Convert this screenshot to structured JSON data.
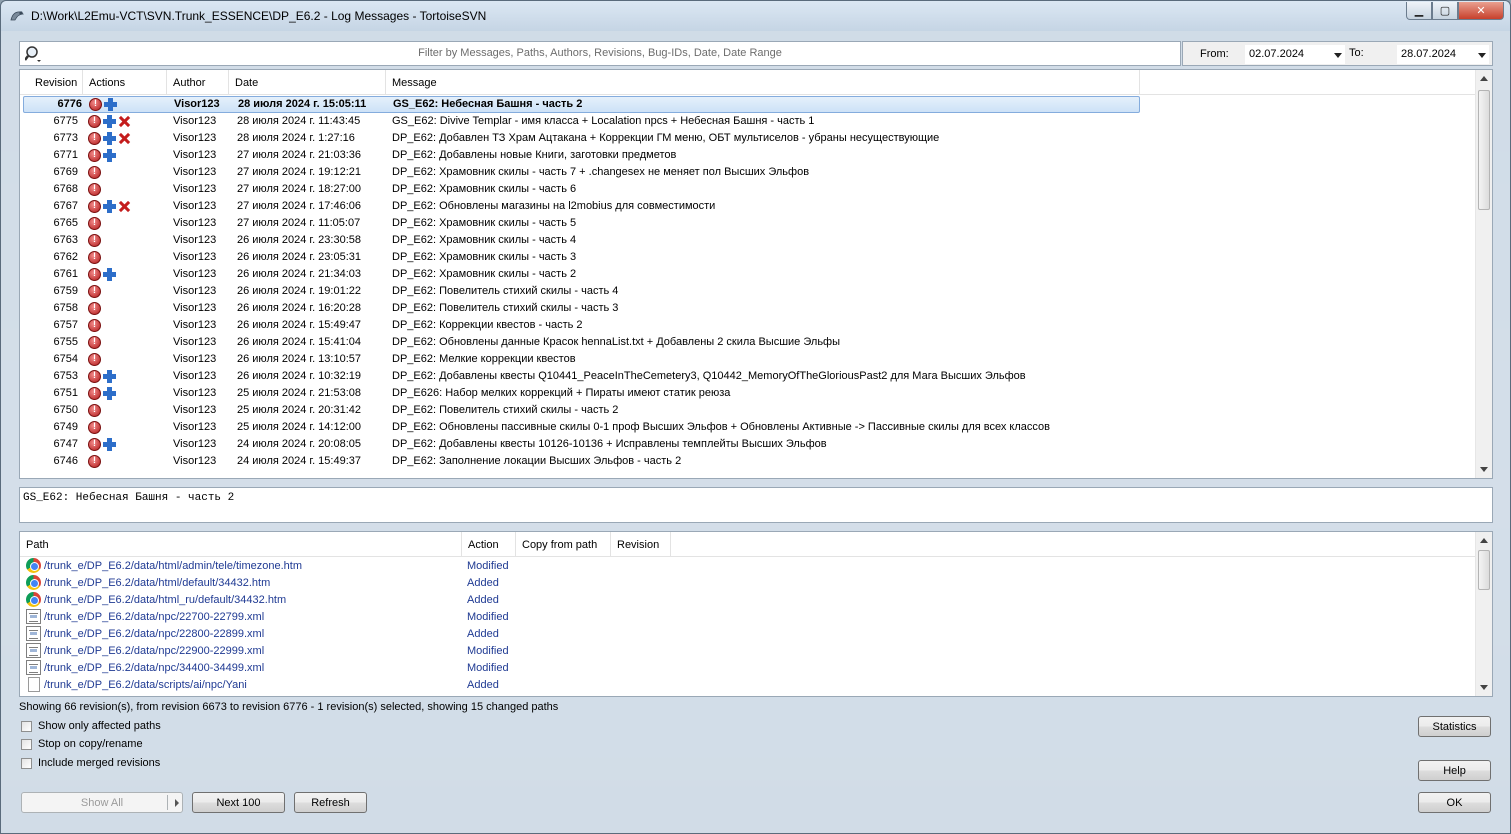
{
  "window": {
    "title": "D:\\Work\\L2Emu-VCT\\SVN.Trunk_ESSENCE\\DP_E6.2 - Log Messages - TortoiseSVN"
  },
  "filter": {
    "placeholder": "Filter by Messages, Paths, Authors, Revisions, Bug-IDs, Date, Date Range",
    "from_label": "From:",
    "from_value": "02.07.2024",
    "to_label": "To:",
    "to_value": "28.07.2024"
  },
  "log_columns": [
    "Revision",
    "Actions",
    "Author",
    "Date",
    "Message"
  ],
  "log_rows": [
    {
      "rev": "6776",
      "actions": [
        "mod",
        "add"
      ],
      "author": "Visor123",
      "date": "28 июля 2024 г. 15:05:11",
      "msg": "GS_E62: Небесная Башня - часть 2",
      "selected": true
    },
    {
      "rev": "6775",
      "actions": [
        "mod",
        "add",
        "del"
      ],
      "author": "Visor123",
      "date": "28 июля 2024 г. 11:43:45",
      "msg": "GS_E62: Divive Templar - имя класса + Localation npcs + Небесная Башня - часть 1"
    },
    {
      "rev": "6773",
      "actions": [
        "mod",
        "add",
        "del"
      ],
      "author": "Visor123",
      "date": "28 июля 2024 г. 1:27:16",
      "msg": "DP_E62: Добавлен ТЗ Храм Ацтакана + Коррекции ГМ меню, ОБТ мультиселов - убраны несуществующие"
    },
    {
      "rev": "6771",
      "actions": [
        "mod",
        "add"
      ],
      "author": "Visor123",
      "date": "27 июля 2024 г. 21:03:36",
      "msg": "DP_E62: Добавлены новые Книги, заготовки предметов"
    },
    {
      "rev": "6769",
      "actions": [
        "mod"
      ],
      "author": "Visor123",
      "date": "27 июля 2024 г. 19:12:21",
      "msg": "DP_E62: Храмовник скилы - часть 7 + .changesex не меняет пол Высших Эльфов"
    },
    {
      "rev": "6768",
      "actions": [
        "mod"
      ],
      "author": "Visor123",
      "date": "27 июля 2024 г. 18:27:00",
      "msg": "DP_E62: Храмовник скилы - часть 6"
    },
    {
      "rev": "6767",
      "actions": [
        "mod",
        "add",
        "del"
      ],
      "author": "Visor123",
      "date": "27 июля 2024 г. 17:46:06",
      "msg": "DP_E62: Обновлены магазины на l2mobius для совместимости"
    },
    {
      "rev": "6765",
      "actions": [
        "mod"
      ],
      "author": "Visor123",
      "date": "27 июля 2024 г. 11:05:07",
      "msg": "DP_E62: Храмовник скилы - часть 5"
    },
    {
      "rev": "6763",
      "actions": [
        "mod"
      ],
      "author": "Visor123",
      "date": "26 июля 2024 г. 23:30:58",
      "msg": "DP_E62: Храмовник скилы - часть 4"
    },
    {
      "rev": "6762",
      "actions": [
        "mod"
      ],
      "author": "Visor123",
      "date": "26 июля 2024 г. 23:05:31",
      "msg": "DP_E62: Храмовник скилы - часть 3"
    },
    {
      "rev": "6761",
      "actions": [
        "mod",
        "add"
      ],
      "author": "Visor123",
      "date": "26 июля 2024 г. 21:34:03",
      "msg": "DP_E62: Храмовник скилы - часть 2"
    },
    {
      "rev": "6759",
      "actions": [
        "mod"
      ],
      "author": "Visor123",
      "date": "26 июля 2024 г. 19:01:22",
      "msg": "DP_E62: Повелитель стихий скилы - часть 4"
    },
    {
      "rev": "6758",
      "actions": [
        "mod"
      ],
      "author": "Visor123",
      "date": "26 июля 2024 г. 16:20:28",
      "msg": "DP_E62: Повелитель стихий скилы - часть 3"
    },
    {
      "rev": "6757",
      "actions": [
        "mod"
      ],
      "author": "Visor123",
      "date": "26 июля 2024 г. 15:49:47",
      "msg": "DP_E62: Коррекции квестов - часть 2"
    },
    {
      "rev": "6755",
      "actions": [
        "mod"
      ],
      "author": "Visor123",
      "date": "26 июля 2024 г. 15:41:04",
      "msg": "DP_E62: Обновлены данные Красок hennaList.txt + Добавлены 2 скила Высшие Эльфы"
    },
    {
      "rev": "6754",
      "actions": [
        "mod"
      ],
      "author": "Visor123",
      "date": "26 июля 2024 г. 13:10:57",
      "msg": "DP_E62: Мелкие коррекции квестов"
    },
    {
      "rev": "6753",
      "actions": [
        "mod",
        "add"
      ],
      "author": "Visor123",
      "date": "26 июля 2024 г. 10:32:19",
      "msg": "DP_E62: Добавлены квесты Q10441_PeaceInTheCemetery3, Q10442_MemoryOfTheGloriousPast2 для Мага Высших Эльфов"
    },
    {
      "rev": "6751",
      "actions": [
        "mod",
        "add"
      ],
      "author": "Visor123",
      "date": "25 июля 2024 г. 21:53:08",
      "msg": "DP_E626: Набор мелких коррекций + Пираты имеют статик реюза"
    },
    {
      "rev": "6750",
      "actions": [
        "mod"
      ],
      "author": "Visor123",
      "date": "25 июля 2024 г. 20:31:42",
      "msg": "DP_E62: Повелитель стихий скилы - часть 2"
    },
    {
      "rev": "6749",
      "actions": [
        "mod"
      ],
      "author": "Visor123",
      "date": "25 июля 2024 г. 14:12:00",
      "msg": "DP_E62: Обновлены  пассивные скилы 0-1 проф Высших Эльфов + Обновлены Активные -> Пассивные скилы для всех классов"
    },
    {
      "rev": "6747",
      "actions": [
        "mod",
        "add"
      ],
      "author": "Visor123",
      "date": "24 июля 2024 г. 20:08:05",
      "msg": "DP_E62: Добавлены квесты 10126-10136 + Исправлены темплейты Высших Эльфов"
    },
    {
      "rev": "6746",
      "actions": [
        "mod"
      ],
      "author": "Visor123",
      "date": "24 июля 2024 г. 15:49:37",
      "msg": "DP_E62: Заполнение локации Высших Эльфов - часть 2"
    }
  ],
  "message_text": "GS_E62: Небесная Башня - часть 2",
  "path_columns": [
    "Path",
    "Action",
    "Copy from path",
    "Revision"
  ],
  "path_rows": [
    {
      "icon": "chrome",
      "path": "/trunk_e/DP_E6.2/data/html/admin/tele/timezone.htm",
      "action": "Modified"
    },
    {
      "icon": "chrome",
      "path": "/trunk_e/DP_E6.2/data/html/default/34432.htm",
      "action": "Added"
    },
    {
      "icon": "chrome",
      "path": "/trunk_e/DP_E6.2/data/html_ru/default/34432.htm",
      "action": "Added"
    },
    {
      "icon": "xml",
      "path": "/trunk_e/DP_E6.2/data/npc/22700-22799.xml",
      "action": "Modified"
    },
    {
      "icon": "xml",
      "path": "/trunk_e/DP_E6.2/data/npc/22800-22899.xml",
      "action": "Added"
    },
    {
      "icon": "xml",
      "path": "/trunk_e/DP_E6.2/data/npc/22900-22999.xml",
      "action": "Modified"
    },
    {
      "icon": "xml",
      "path": "/trunk_e/DP_E6.2/data/npc/34400-34499.xml",
      "action": "Modified"
    },
    {
      "icon": "file",
      "path": "/trunk_e/DP_E6.2/data/scripts/ai/npc/Yani",
      "action": "Added"
    }
  ],
  "status": "Showing 66 revision(s), from revision 6673 to revision 6776 - 1 revision(s) selected, showing 15 changed paths",
  "options": {
    "affected_paths": "Show only affected paths",
    "stop_copy": "Stop on copy/rename",
    "merged": "Include merged revisions"
  },
  "buttons": {
    "show_all": "Show All",
    "next100": "Next 100",
    "refresh": "Refresh",
    "statistics": "Statistics",
    "help": "Help",
    "ok": "OK"
  }
}
